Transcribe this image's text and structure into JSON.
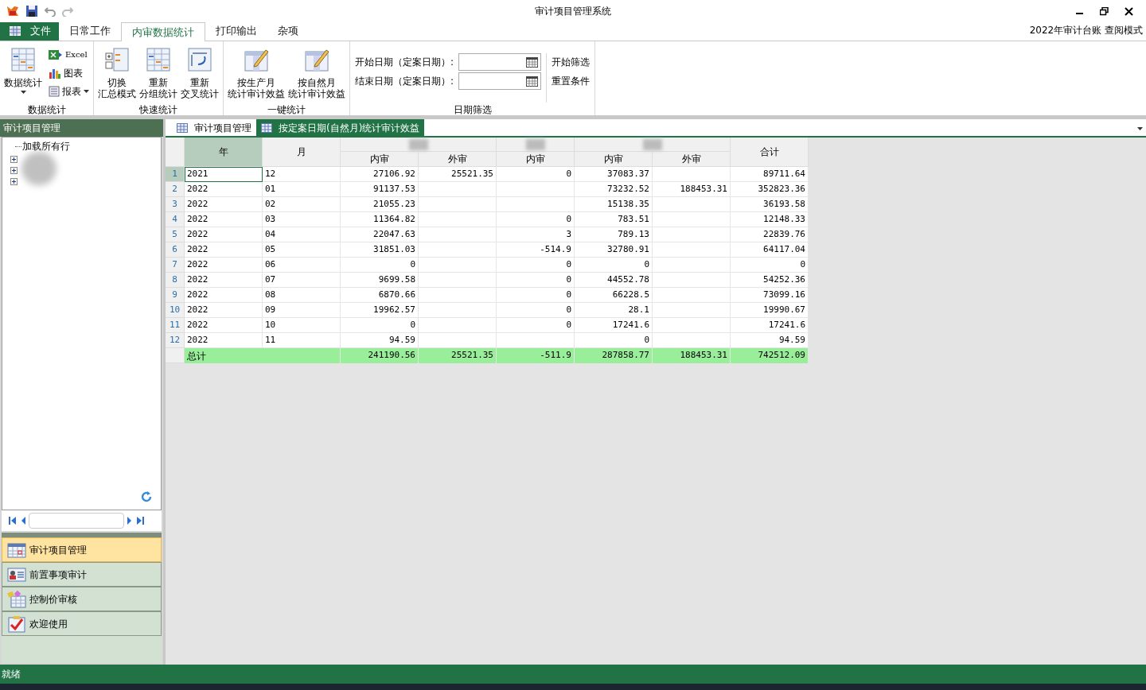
{
  "window": {
    "title": "审计项目管理系统"
  },
  "menu_tabs": [
    {
      "label": "文件",
      "kind": "file",
      "selected": false
    },
    {
      "label": "日常工作",
      "kind": "tab",
      "selected": false
    },
    {
      "label": "内审数据统计",
      "kind": "tab",
      "selected": true
    },
    {
      "label": "打印输出",
      "kind": "tab",
      "selected": false
    },
    {
      "label": "杂项",
      "kind": "tab",
      "selected": false
    }
  ],
  "mode_text": "2022年审计台账 查阅模式",
  "ribbon": {
    "groups": [
      {
        "title": "数据统计",
        "big": [
          {
            "lines": [
              "数据统计"
            ],
            "kind": "grid",
            "dropdown": true
          }
        ],
        "small": [
          {
            "label": "Excel",
            "kind": "excel",
            "dropdown": false
          },
          {
            "label": "图表",
            "kind": "chart",
            "dropdown": false
          },
          {
            "label": "报表",
            "kind": "report",
            "dropdown": true
          }
        ]
      },
      {
        "title": "快速统计",
        "big": [
          {
            "lines": [
              "切换",
              "汇总模式"
            ],
            "kind": "tree",
            "dropdown": false
          },
          {
            "lines": [
              "重新",
              "分组统计"
            ],
            "kind": "grid",
            "dropdown": false
          },
          {
            "lines": [
              "重新",
              "交叉统计"
            ],
            "kind": "cross",
            "dropdown": false
          }
        ]
      },
      {
        "title": "一键统计",
        "big": [
          {
            "lines": [
              "按生产月",
              "统计审计效益"
            ],
            "kind": "pencil",
            "dropdown": false
          },
          {
            "lines": [
              "按自然月",
              "统计审计效益"
            ],
            "kind": "pencil",
            "dropdown": false
          }
        ]
      }
    ],
    "date_filter": {
      "title": "日期筛选",
      "fields": [
        {
          "label": "开始日期（定案日期）:"
        },
        {
          "label": "结束日期（定案日期）:"
        }
      ],
      "actions": [
        "开始筛选",
        "重置条件"
      ]
    }
  },
  "left_panel": {
    "title": "审计项目管理",
    "tree": {
      "root": "加载所有行",
      "items": [
        {
          "expanded": false
        },
        {
          "expanded": false
        },
        {
          "expanded": false
        }
      ]
    },
    "outlook": [
      {
        "label": "审计项目管理",
        "kind": "calendar",
        "selected": true
      },
      {
        "label": "前置事项审计",
        "kind": "card",
        "selected": false
      },
      {
        "label": "控制价审核",
        "kind": "table",
        "selected": false
      },
      {
        "label": "欢迎使用",
        "kind": "check",
        "selected": false
      }
    ]
  },
  "doc_tabs": [
    {
      "label": "审计项目管理",
      "selected": false
    },
    {
      "label": "按定案日期(自然月)统计审计效益",
      "selected": true
    }
  ],
  "table": {
    "columns": [
      "年",
      "月"
    ],
    "groups": [
      {
        "subs": [
          "内审",
          "外审"
        ]
      },
      {
        "subs": [
          "内审"
        ]
      },
      {
        "subs": [
          "内审",
          "外审"
        ]
      }
    ],
    "total_column": "合计",
    "rows": [
      {
        "num": "1",
        "selected": true,
        "cells": [
          "2021",
          "12",
          "27106.92",
          "25521.35",
          "0",
          "37083.37",
          "",
          "89711.64"
        ]
      },
      {
        "num": "2",
        "selected": false,
        "cells": [
          "2022",
          "01",
          "91137.53",
          "",
          "",
          "73232.52",
          "188453.31",
          "352823.36"
        ]
      },
      {
        "num": "3",
        "selected": false,
        "cells": [
          "2022",
          "02",
          "21055.23",
          "",
          "",
          "15138.35",
          "",
          "36193.58"
        ]
      },
      {
        "num": "4",
        "selected": false,
        "cells": [
          "2022",
          "03",
          "11364.82",
          "",
          "0",
          "783.51",
          "",
          "12148.33"
        ]
      },
      {
        "num": "5",
        "selected": false,
        "cells": [
          "2022",
          "04",
          "22047.63",
          "",
          "3",
          "789.13",
          "",
          "22839.76"
        ]
      },
      {
        "num": "6",
        "selected": false,
        "cells": [
          "2022",
          "05",
          "31851.03",
          "",
          "-514.9",
          "32780.91",
          "",
          "64117.04"
        ]
      },
      {
        "num": "7",
        "selected": false,
        "cells": [
          "2022",
          "06",
          "0",
          "",
          "0",
          "0",
          "",
          "0"
        ]
      },
      {
        "num": "8",
        "selected": false,
        "cells": [
          "2022",
          "07",
          "9699.58",
          "",
          "0",
          "44552.78",
          "",
          "54252.36"
        ]
      },
      {
        "num": "9",
        "selected": false,
        "cells": [
          "2022",
          "08",
          "6870.66",
          "",
          "0",
          "66228.5",
          "",
          "73099.16"
        ]
      },
      {
        "num": "10",
        "selected": false,
        "cells": [
          "2022",
          "09",
          "19962.57",
          "",
          "0",
          "28.1",
          "",
          "19990.67"
        ]
      },
      {
        "num": "11",
        "selected": false,
        "cells": [
          "2022",
          "10",
          "0",
          "",
          "0",
          "17241.6",
          "",
          "17241.6"
        ]
      },
      {
        "num": "12",
        "selected": false,
        "cells": [
          "2022",
          "11",
          "94.59",
          "",
          "",
          "0",
          "",
          "94.59"
        ]
      }
    ],
    "total_row": {
      "label": "总计",
      "cells": [
        "241190.56",
        "25521.35",
        "-511.9",
        "287858.77",
        "188453.31",
        "742512.09"
      ]
    }
  },
  "status_bar": {
    "text": "就绪"
  }
}
